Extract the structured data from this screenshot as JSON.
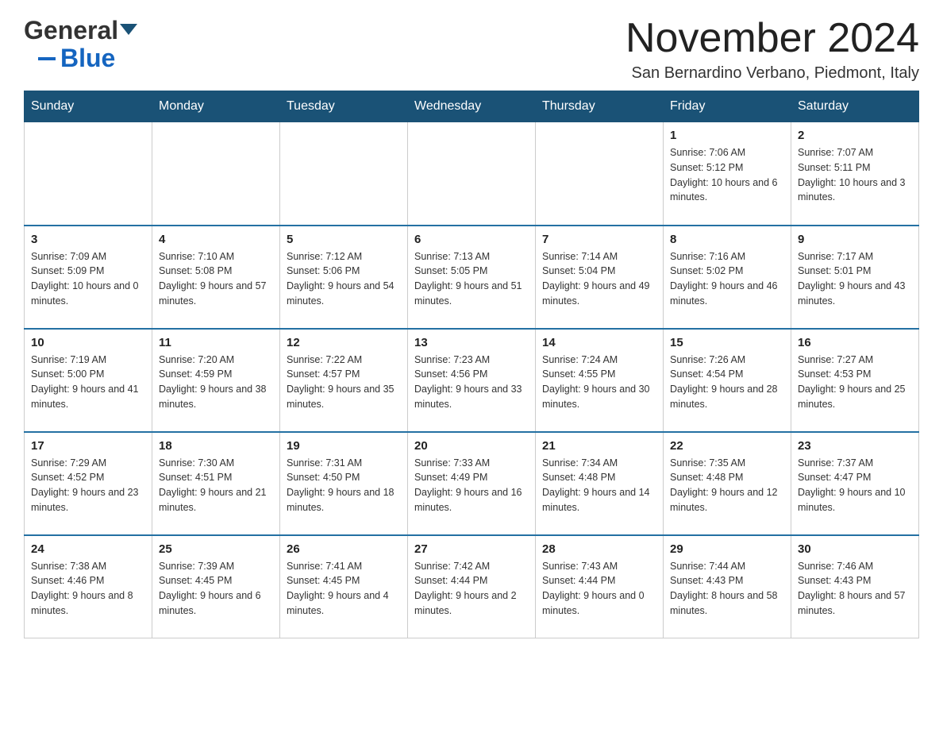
{
  "header": {
    "logo_general": "General",
    "logo_blue": "Blue",
    "main_title": "November 2024",
    "subtitle": "San Bernardino Verbano, Piedmont, Italy"
  },
  "calendar": {
    "days_of_week": [
      "Sunday",
      "Monday",
      "Tuesday",
      "Wednesday",
      "Thursday",
      "Friday",
      "Saturday"
    ],
    "weeks": [
      {
        "days": [
          {
            "number": "",
            "info": ""
          },
          {
            "number": "",
            "info": ""
          },
          {
            "number": "",
            "info": ""
          },
          {
            "number": "",
            "info": ""
          },
          {
            "number": "",
            "info": ""
          },
          {
            "number": "1",
            "info": "Sunrise: 7:06 AM\nSunset: 5:12 PM\nDaylight: 10 hours and 6 minutes."
          },
          {
            "number": "2",
            "info": "Sunrise: 7:07 AM\nSunset: 5:11 PM\nDaylight: 10 hours and 3 minutes."
          }
        ]
      },
      {
        "days": [
          {
            "number": "3",
            "info": "Sunrise: 7:09 AM\nSunset: 5:09 PM\nDaylight: 10 hours and 0 minutes."
          },
          {
            "number": "4",
            "info": "Sunrise: 7:10 AM\nSunset: 5:08 PM\nDaylight: 9 hours and 57 minutes."
          },
          {
            "number": "5",
            "info": "Sunrise: 7:12 AM\nSunset: 5:06 PM\nDaylight: 9 hours and 54 minutes."
          },
          {
            "number": "6",
            "info": "Sunrise: 7:13 AM\nSunset: 5:05 PM\nDaylight: 9 hours and 51 minutes."
          },
          {
            "number": "7",
            "info": "Sunrise: 7:14 AM\nSunset: 5:04 PM\nDaylight: 9 hours and 49 minutes."
          },
          {
            "number": "8",
            "info": "Sunrise: 7:16 AM\nSunset: 5:02 PM\nDaylight: 9 hours and 46 minutes."
          },
          {
            "number": "9",
            "info": "Sunrise: 7:17 AM\nSunset: 5:01 PM\nDaylight: 9 hours and 43 minutes."
          }
        ]
      },
      {
        "days": [
          {
            "number": "10",
            "info": "Sunrise: 7:19 AM\nSunset: 5:00 PM\nDaylight: 9 hours and 41 minutes."
          },
          {
            "number": "11",
            "info": "Sunrise: 7:20 AM\nSunset: 4:59 PM\nDaylight: 9 hours and 38 minutes."
          },
          {
            "number": "12",
            "info": "Sunrise: 7:22 AM\nSunset: 4:57 PM\nDaylight: 9 hours and 35 minutes."
          },
          {
            "number": "13",
            "info": "Sunrise: 7:23 AM\nSunset: 4:56 PM\nDaylight: 9 hours and 33 minutes."
          },
          {
            "number": "14",
            "info": "Sunrise: 7:24 AM\nSunset: 4:55 PM\nDaylight: 9 hours and 30 minutes."
          },
          {
            "number": "15",
            "info": "Sunrise: 7:26 AM\nSunset: 4:54 PM\nDaylight: 9 hours and 28 minutes."
          },
          {
            "number": "16",
            "info": "Sunrise: 7:27 AM\nSunset: 4:53 PM\nDaylight: 9 hours and 25 minutes."
          }
        ]
      },
      {
        "days": [
          {
            "number": "17",
            "info": "Sunrise: 7:29 AM\nSunset: 4:52 PM\nDaylight: 9 hours and 23 minutes."
          },
          {
            "number": "18",
            "info": "Sunrise: 7:30 AM\nSunset: 4:51 PM\nDaylight: 9 hours and 21 minutes."
          },
          {
            "number": "19",
            "info": "Sunrise: 7:31 AM\nSunset: 4:50 PM\nDaylight: 9 hours and 18 minutes."
          },
          {
            "number": "20",
            "info": "Sunrise: 7:33 AM\nSunset: 4:49 PM\nDaylight: 9 hours and 16 minutes."
          },
          {
            "number": "21",
            "info": "Sunrise: 7:34 AM\nSunset: 4:48 PM\nDaylight: 9 hours and 14 minutes."
          },
          {
            "number": "22",
            "info": "Sunrise: 7:35 AM\nSunset: 4:48 PM\nDaylight: 9 hours and 12 minutes."
          },
          {
            "number": "23",
            "info": "Sunrise: 7:37 AM\nSunset: 4:47 PM\nDaylight: 9 hours and 10 minutes."
          }
        ]
      },
      {
        "days": [
          {
            "number": "24",
            "info": "Sunrise: 7:38 AM\nSunset: 4:46 PM\nDaylight: 9 hours and 8 minutes."
          },
          {
            "number": "25",
            "info": "Sunrise: 7:39 AM\nSunset: 4:45 PM\nDaylight: 9 hours and 6 minutes."
          },
          {
            "number": "26",
            "info": "Sunrise: 7:41 AM\nSunset: 4:45 PM\nDaylight: 9 hours and 4 minutes."
          },
          {
            "number": "27",
            "info": "Sunrise: 7:42 AM\nSunset: 4:44 PM\nDaylight: 9 hours and 2 minutes."
          },
          {
            "number": "28",
            "info": "Sunrise: 7:43 AM\nSunset: 4:44 PM\nDaylight: 9 hours and 0 minutes."
          },
          {
            "number": "29",
            "info": "Sunrise: 7:44 AM\nSunset: 4:43 PM\nDaylight: 8 hours and 58 minutes."
          },
          {
            "number": "30",
            "info": "Sunrise: 7:46 AM\nSunset: 4:43 PM\nDaylight: 8 hours and 57 minutes."
          }
        ]
      }
    ]
  }
}
